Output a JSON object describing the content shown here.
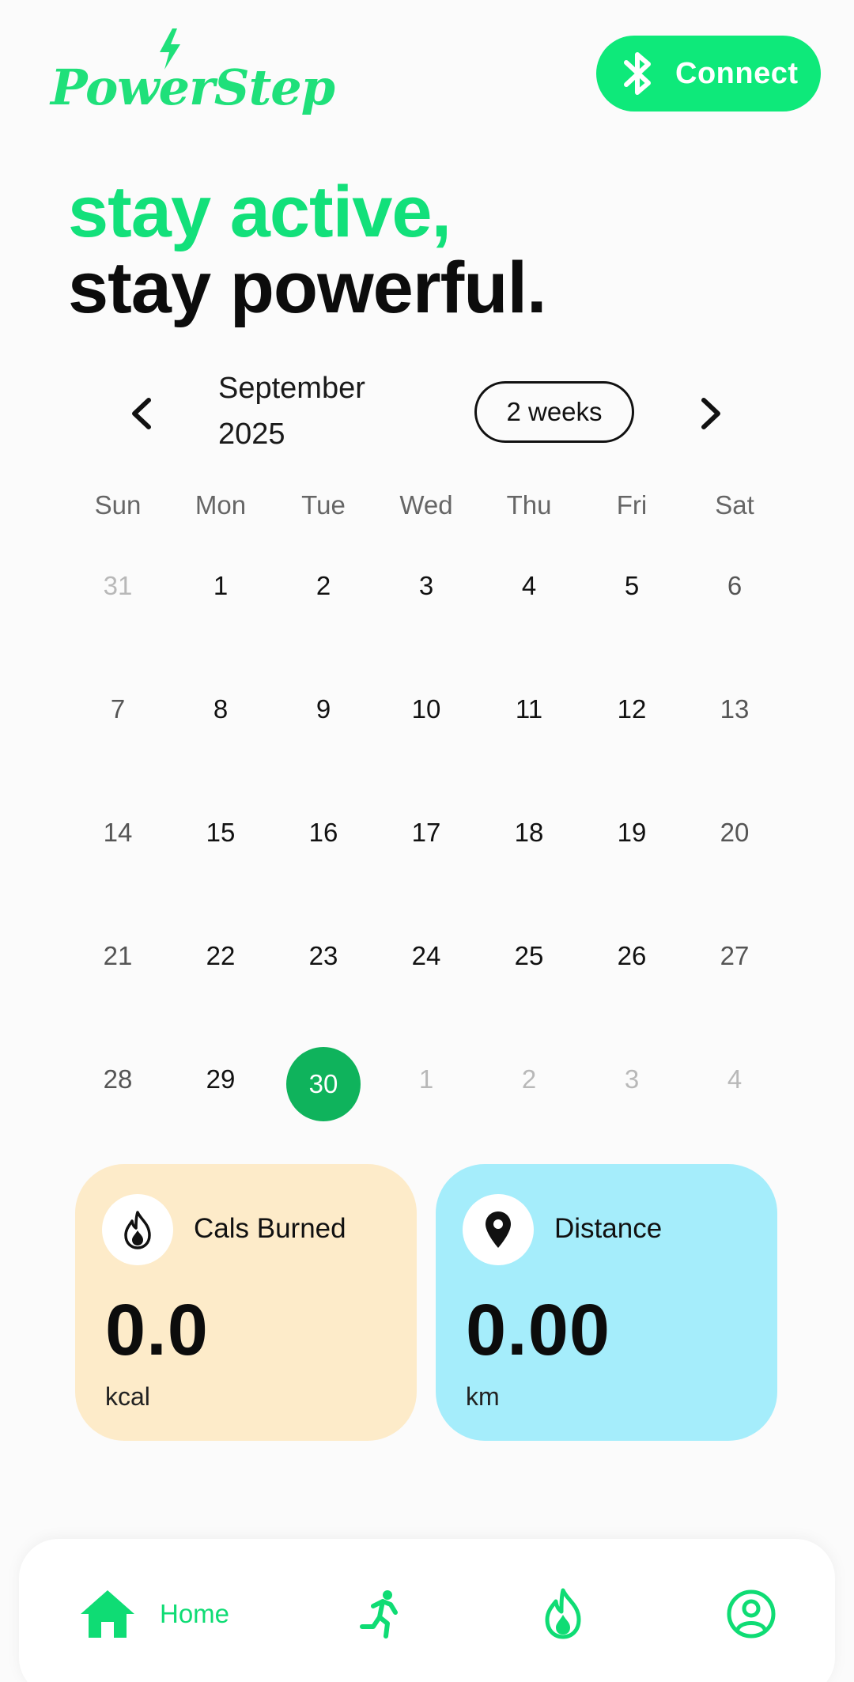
{
  "app": {
    "brand": "PowerStep",
    "accent": "#0ee97a",
    "connect_label": "Connect"
  },
  "headline": {
    "line1": "stay active,",
    "line2": "stay powerful."
  },
  "calendar": {
    "month": "September",
    "year": "2025",
    "range": "2 weeks",
    "weekdays": [
      "Sun",
      "Mon",
      "Tue",
      "Wed",
      "Thu",
      "Fri",
      "Sat"
    ],
    "weeks": [
      [
        "31",
        "1",
        "2",
        "3",
        "4",
        "5",
        "6"
      ],
      [
        "7",
        "8",
        "9",
        "10",
        "11",
        "12",
        "13"
      ],
      [
        "14",
        "15",
        "16",
        "17",
        "18",
        "19",
        "20"
      ],
      [
        "21",
        "22",
        "23",
        "24",
        "25",
        "26",
        "27"
      ],
      [
        "28",
        "29",
        "30",
        "1",
        "2",
        "3",
        "4"
      ]
    ],
    "selected_day": "30"
  },
  "stats": {
    "calories": {
      "title": "Cals Burned",
      "value": "0.0",
      "unit": "kcal",
      "icon": "flame-icon",
      "color": "#fdebc9"
    },
    "distance": {
      "title": "Distance",
      "value": "0.00",
      "unit": "km",
      "icon": "location-pin-icon",
      "color": "#a5edfb"
    }
  },
  "bottom_nav": {
    "home_label": "Home",
    "items": [
      "home-icon",
      "running-icon",
      "flame-icon",
      "profile-icon"
    ]
  }
}
